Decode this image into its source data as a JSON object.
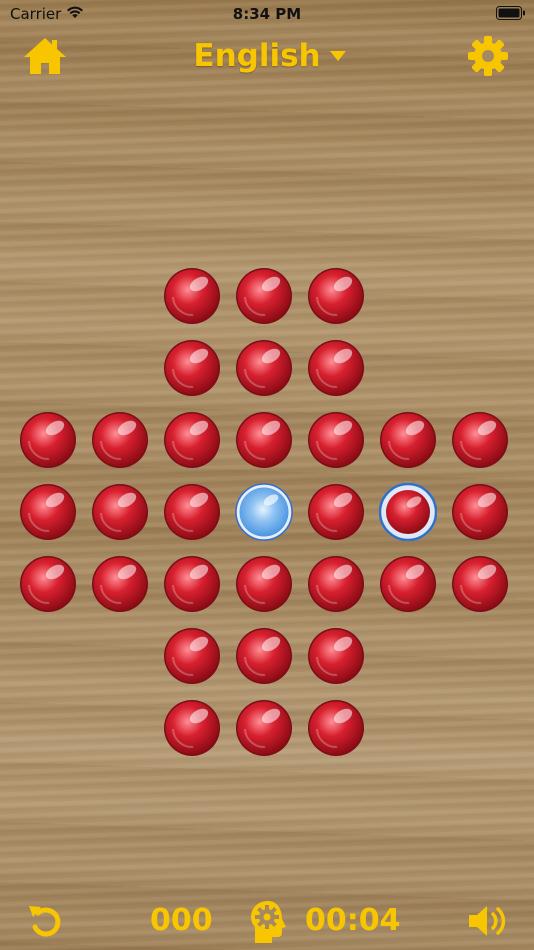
{
  "status_bar": {
    "carrier": "Carrier",
    "time": "8:34 PM",
    "wifi_icon": "wifi-icon",
    "battery_icon": "battery-icon"
  },
  "header": {
    "home_icon": "home-icon",
    "language": "English",
    "language_dropdown_icon": "chevron-down-icon",
    "settings_icon": "gear-icon"
  },
  "board": {
    "type": "peg-solitaire-english",
    "size": 7,
    "rows": [
      [
        "none",
        "none",
        "peg",
        "peg",
        "peg",
        "none",
        "none"
      ],
      [
        "none",
        "none",
        "peg",
        "peg",
        "peg",
        "none",
        "none"
      ],
      [
        "peg",
        "peg",
        "peg",
        "peg",
        "peg",
        "peg",
        "peg"
      ],
      [
        "peg",
        "peg",
        "peg",
        "empty",
        "peg",
        "peg-selected",
        "peg"
      ],
      [
        "peg",
        "peg",
        "peg",
        "peg",
        "peg",
        "peg",
        "peg"
      ],
      [
        "none",
        "none",
        "peg",
        "peg",
        "peg",
        "none",
        "none"
      ],
      [
        "none",
        "none",
        "peg",
        "peg",
        "peg",
        "none",
        "none"
      ]
    ],
    "empty_hole_position": [
      3,
      3
    ],
    "selected_peg_position": [
      3,
      5
    ],
    "peg_color": "#d8202f",
    "empty_hole_color": "#3f8fe0",
    "selection_ring_color": "#2f6fce"
  },
  "footer": {
    "undo_icon": "undo-icon",
    "moves": "000",
    "hint_icon": "brain-gear-icon",
    "timer": "00:04",
    "sound_icon": "speaker-icon"
  },
  "colors": {
    "accent": "#f7c600",
    "wood": "#a88a5e"
  }
}
